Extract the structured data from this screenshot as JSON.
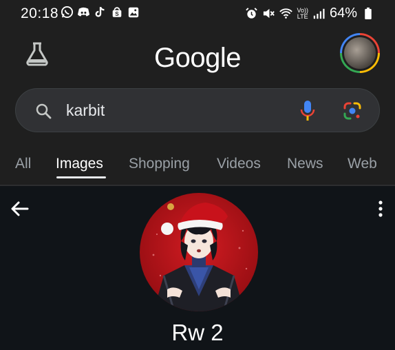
{
  "status_bar": {
    "time": "20:18",
    "left_icons": [
      "whatsapp-icon",
      "discord-icon",
      "tiktok-icon",
      "shopee-icon",
      "gallery-icon"
    ],
    "right_icons": [
      "alarm-icon",
      "mute-icon",
      "wifi-icon",
      "volte-icon",
      "signal-icon",
      "battery-icon"
    ],
    "volte_top": "Vo))",
    "volte_bottom": "LTE",
    "battery_text": "64%"
  },
  "header": {
    "logo": "Google",
    "labs_icon": "labs-flask-icon",
    "account_avatar": "account-avatar"
  },
  "search": {
    "query": "karbit",
    "icons": [
      "search-icon",
      "voice-search-icon",
      "google-lens-icon"
    ],
    "colors": {
      "mic_blue": "#4285f4",
      "mic_red": "#ea4335",
      "lens_yellow": "#fbbc05",
      "lens_green": "#34a853"
    }
  },
  "tabs": [
    {
      "label": "All",
      "active": false
    },
    {
      "label": "Images",
      "active": true
    },
    {
      "label": "Shopping",
      "active": false
    },
    {
      "label": "Videos",
      "active": false
    },
    {
      "label": "News",
      "active": false
    },
    {
      "label": "Web",
      "active": false
    }
  ],
  "detail": {
    "title": "Rw 2",
    "back_icon": "arrow-left-icon",
    "menu_icon": "more-vert-icon",
    "image": "anime-character-santa-hat-avatar"
  }
}
